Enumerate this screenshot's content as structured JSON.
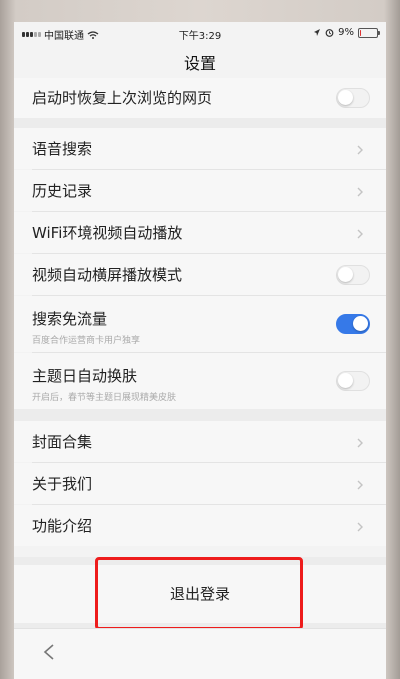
{
  "status_bar": {
    "carrier": "中国联通",
    "time": "下午3:29",
    "battery": "9%",
    "battery_level": 0.09,
    "icons": [
      "signal-icon",
      "wifi-icon",
      "location-icon",
      "alarm-icon",
      "battery-icon"
    ]
  },
  "header": {
    "title": "设置"
  },
  "settings": {
    "restore_last_page": {
      "label": "启动时恢复上次浏览的网页",
      "enabled": false
    },
    "voice_search": {
      "label": "语音搜索"
    },
    "history": {
      "label": "历史记录"
    },
    "wifi_autoplay": {
      "label": "WiFi环境视频自动播放"
    },
    "auto_landscape": {
      "label": "视频自动横屏播放模式",
      "enabled": false
    },
    "free_data_search": {
      "label": "搜索免流量",
      "sub": "百度合作运营商卡用户独享",
      "enabled": true
    },
    "theme_day_skin": {
      "label": "主题日自动换肤",
      "sub": "开启后，春节等主题日展现精美皮肤",
      "enabled": false
    },
    "cover_collection": {
      "label": "封面合集"
    },
    "about_us": {
      "label": "关于我们"
    },
    "feature_intro": {
      "label": "功能介绍"
    }
  },
  "logout": {
    "label": "退出登录"
  },
  "colors": {
    "toggle_on": "#3679e8",
    "highlight": "#ee1c1c"
  },
  "bottom_bar": {
    "icon": "back-arrow-icon"
  }
}
